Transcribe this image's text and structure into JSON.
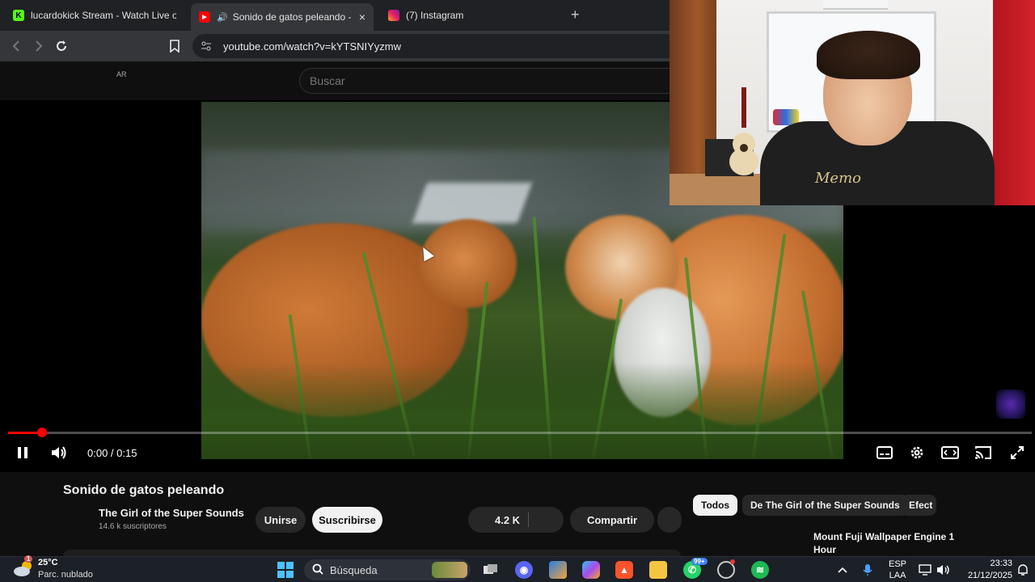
{
  "browser": {
    "tabs": [
      {
        "title": "lucardokick Stream - Watch Live on K",
        "favicon": "kick-icon",
        "active": false
      },
      {
        "title": "Sonido de gatos peleando - Y",
        "favicon": "youtube-icon",
        "active": true,
        "audio": true
      },
      {
        "title": "(7) Instagram",
        "favicon": "instagram-icon",
        "active": false
      }
    ],
    "new_tab": "+",
    "close": "×",
    "url": "youtube.com/watch?v=kYTSNIYyzmw"
  },
  "youtube": {
    "country": "AR",
    "search_placeholder": "Buscar"
  },
  "player": {
    "time": "0:00 / 0:15",
    "progress_fraction": 0.033
  },
  "video_info": {
    "title": "Sonido de gatos peleando",
    "channel": "The Girl of the Super Sounds",
    "subscribers": "14.6 k suscriptores",
    "join_label": "Unirse",
    "subscribe_label": "Suscribirse",
    "likes": "4.2 K",
    "share_label": "Compartir"
  },
  "chips": [
    "Todos",
    "De The Girl of the Super Sounds",
    "Efect"
  ],
  "recommendation": {
    "title": "Mount Fuji Wallpaper Engine 1 Hour"
  },
  "webcam": {
    "shirt_text": "Memo"
  },
  "taskbar": {
    "weather_temp": "25°C",
    "weather_desc": "Parc. nublado",
    "weather_badge": "1",
    "search_label": "Búsqueda",
    "whatsapp_badge": "99+",
    "lang_top": "ESP",
    "lang_bottom": "LAA",
    "time": "23:33",
    "date": "21/12/2025"
  },
  "colors": {
    "progress": "#ff0000",
    "youtube_red": "#ff0000",
    "kick_green": "#53fc18"
  }
}
